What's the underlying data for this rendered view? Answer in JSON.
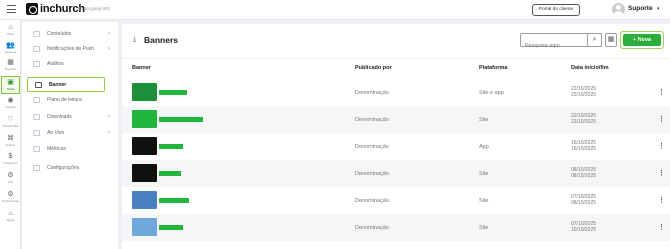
{
  "topbar": {
    "logo_text": "inchurch",
    "church_name": "ID da Igreja 883",
    "portal_button": "Portal do cliente",
    "user_name": "Suporte",
    "user_caret": "▾"
  },
  "rail": {
    "items": [
      {
        "label": "Início",
        "icon": "home-icon",
        "glyph": "⌂"
      },
      {
        "label": "Pessoas",
        "icon": "people-icon",
        "glyph": "👥"
      },
      {
        "label": "Eventos",
        "icon": "calendar-icon",
        "glyph": "▦"
      },
      {
        "label": "Mídia",
        "icon": "media-icon",
        "glyph": "▣"
      },
      {
        "label": "Células",
        "icon": "cells-icon",
        "glyph": "◉"
      },
      {
        "label": "Intercessão",
        "icon": "prayer-icon",
        "glyph": "♡"
      },
      {
        "label": "Ensino",
        "icon": "teaching-icon",
        "glyph": "⌘"
      },
      {
        "label": "Financeiro",
        "icon": "finance-icon",
        "glyph": "$"
      },
      {
        "label": "API",
        "icon": "api-icon",
        "glyph": "⚙"
      },
      {
        "label": "Preferências",
        "icon": "preferences-icon",
        "glyph": "⚙"
      },
      {
        "label": "Igreja",
        "icon": "church-icon",
        "glyph": "⌂"
      }
    ]
  },
  "submenu": {
    "items": [
      {
        "label": "Conteúdos",
        "chevron": "›"
      },
      {
        "label": "Notificações de Push",
        "chevron": "›"
      },
      {
        "label": "Atalhos",
        "chevron": ""
      },
      {
        "label": "Banner",
        "chevron": ""
      },
      {
        "label": "Plano de leitura",
        "chevron": ""
      },
      {
        "label": "Downloads",
        "chevron": "›"
      },
      {
        "label": "Ao Vivo",
        "chevron": "›"
      },
      {
        "label": "Métricas",
        "chevron": ""
      },
      {
        "label": "Configurações",
        "chevron": ""
      }
    ]
  },
  "main": {
    "title": "Banners",
    "title_icon": "⤓",
    "search_placeholder": "Pesquise aqui",
    "search_icon": "⌕",
    "grid_icon": "▦",
    "new_button": "+ Nova",
    "columns": {
      "banner": "Banner",
      "published_by": "Publicado por",
      "platform": "Plataforma",
      "dates": "Data início/fim"
    },
    "row_menu": "⋮",
    "rows": [
      {
        "published_by": "Denominação",
        "platform": "Site e app",
        "start": "22/10/2025",
        "end": "23/10/2025",
        "thumb_color": "#1c8f3a"
      },
      {
        "published_by": "Denominação",
        "platform": "Site",
        "start": "22/10/2025",
        "end": "23/10/2025",
        "thumb_color": "#21b53b"
      },
      {
        "published_by": "Denominação",
        "platform": "App",
        "start": "16/10/2025",
        "end": "16/10/2025",
        "thumb_color": "#111111"
      },
      {
        "published_by": "Denominação",
        "platform": "Site",
        "start": "08/10/2025",
        "end": "08/10/2025",
        "thumb_color": "#111111"
      },
      {
        "published_by": "Denominação",
        "platform": "Site",
        "start": "07/10/2025",
        "end": "08/10/2025",
        "thumb_color": "#4a7fc4"
      },
      {
        "published_by": "Denominação",
        "platform": "Site",
        "start": "07/10/2025",
        "end": "10/10/2025",
        "thumb_color": "#6fa8dc"
      }
    ]
  }
}
